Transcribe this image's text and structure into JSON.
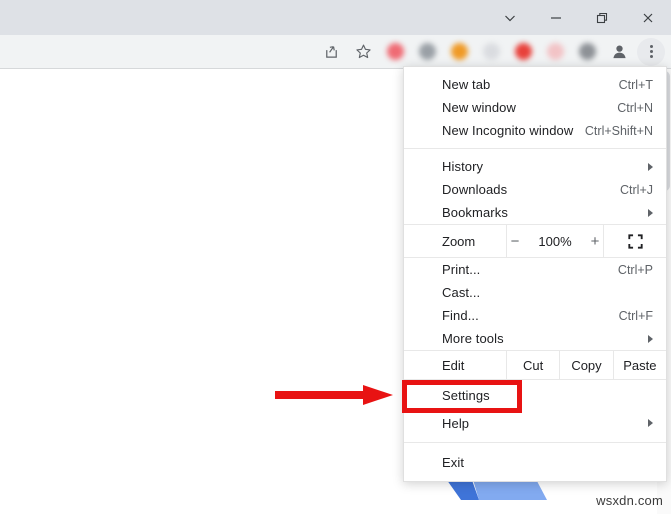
{
  "window": {
    "controls": [
      {
        "name": "chevron-down",
        "label": "∨"
      },
      {
        "name": "minimize",
        "label": "—"
      },
      {
        "name": "restore",
        "label": "□"
      },
      {
        "name": "close",
        "label": "✕"
      }
    ]
  },
  "toolbar": {
    "share_icon": "share-icon",
    "bookmark_icon": "star-icon",
    "profile_icon": "profile-avatar-icon",
    "menu_icon": "three-dot-menu-icon",
    "extensions": [
      {
        "name": "extension-icon-1",
        "color": "#ef6b74"
      },
      {
        "name": "extension-icon-2",
        "color": "#9aa0a6"
      },
      {
        "name": "extension-icon-3",
        "color": "#ef9a26"
      },
      {
        "name": "extension-icon-4",
        "color": "#dadce0"
      },
      {
        "name": "extension-icon-5",
        "color": "#e8413b"
      },
      {
        "name": "extension-icon-6",
        "color": "#f2c3c6"
      },
      {
        "name": "extension-icon-7",
        "color": "#8d9196"
      }
    ]
  },
  "menu": {
    "groups": [
      {
        "items": [
          {
            "label": "New tab",
            "accel": "Ctrl+T",
            "submenu": false
          },
          {
            "label": "New window",
            "accel": "Ctrl+N",
            "submenu": false
          },
          {
            "label": "New Incognito window",
            "accel": "Ctrl+Shift+N",
            "submenu": false
          }
        ]
      },
      {
        "items": [
          {
            "label": "History",
            "accel": "",
            "submenu": true
          },
          {
            "label": "Downloads",
            "accel": "Ctrl+J",
            "submenu": false
          },
          {
            "label": "Bookmarks",
            "accel": "",
            "submenu": true
          }
        ]
      },
      {
        "items": [
          {
            "label": "Print...",
            "accel": "Ctrl+P",
            "submenu": false
          },
          {
            "label": "Cast...",
            "accel": "",
            "submenu": false
          },
          {
            "label": "Find...",
            "accel": "Ctrl+F",
            "submenu": false
          },
          {
            "label": "More tools",
            "accel": "",
            "submenu": true
          }
        ]
      }
    ],
    "zoom_row": {
      "label": "Zoom",
      "minus": "−",
      "value": "100%",
      "plus": "+",
      "fullscreen_icon": "fullscreen-icon"
    },
    "edit_row": {
      "label": "Edit",
      "actions": [
        "Cut",
        "Copy",
        "Paste"
      ]
    },
    "settings": {
      "label": "Settings",
      "highlighted": true
    },
    "help": {
      "label": "Help",
      "submenu": true
    },
    "exit": {
      "label": "Exit"
    }
  },
  "annotation": {
    "arrow_color": "#e81313",
    "highlight_color": "#e81313"
  },
  "watermark": {
    "text": "wsxdn.com"
  }
}
